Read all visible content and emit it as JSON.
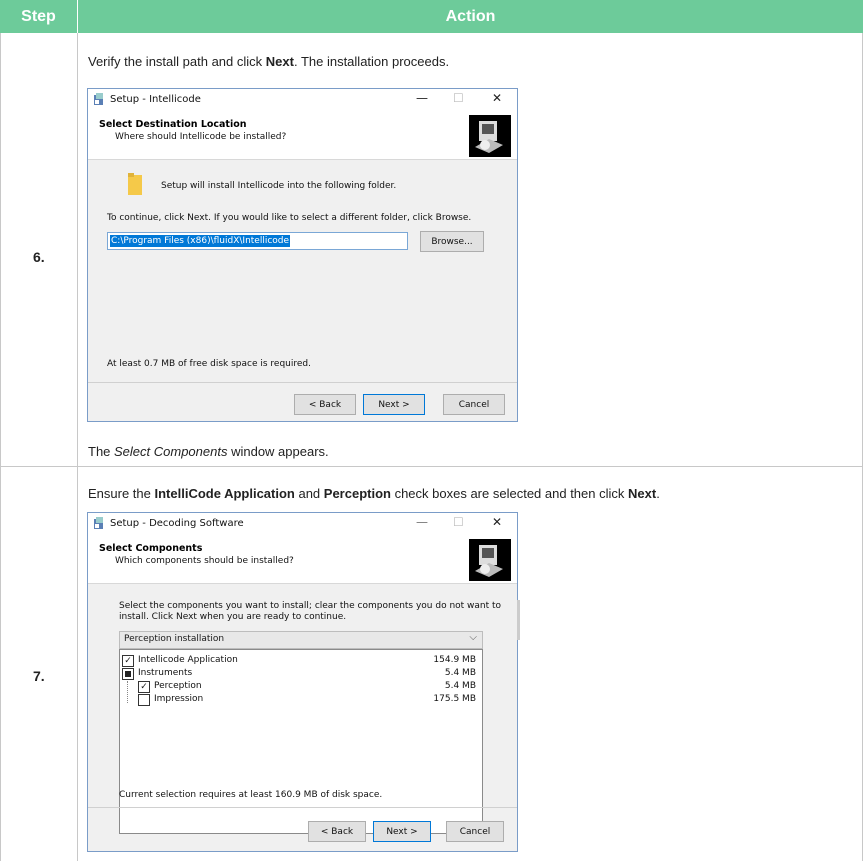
{
  "table": {
    "header_step": "Step",
    "header_action": "Action"
  },
  "step6": {
    "number": "6.",
    "intro_a": "Verify the install path and click ",
    "intro_b": "Next",
    "intro_c": ". The installation proceeds.",
    "outro_a": "The ",
    "outro_b": "Select Components",
    "outro_c": " window appears.",
    "dialog": {
      "title": "Setup - Intellicode",
      "heading": "Select Destination Location",
      "subheading": "Where should Intellicode be installed?",
      "folder_msg": "Setup will install Intellicode into the following folder.",
      "continue_msg": "To continue, click Next. If you would like to select a different folder, click Browse.",
      "path_value": "C:\\Program Files (x86)\\fluidX\\Intellicode",
      "browse_label": "Browse...",
      "space_msg": "At least 0.7 MB of free disk space is required.",
      "back_label": "< Back",
      "next_label": "Next >",
      "cancel_label": "Cancel"
    }
  },
  "step7": {
    "number": "7.",
    "intro_a": "Ensure the ",
    "intro_b": "IntelliCode Application",
    "intro_c": " and ",
    "intro_d": "Perception",
    "intro_e": " check boxes are selected and then click ",
    "intro_f": "Next",
    "intro_g": ".",
    "dialog": {
      "title": "Setup - Decoding Software",
      "heading": "Select Components",
      "subheading": "Which components should be installed?",
      "instr_line1": "Select the components you want to install; clear the components you do not want to",
      "instr_line2": "install. Click Next when you are ready to continue.",
      "dropdown_value": "Perception installation",
      "components": [
        {
          "label": "Intellicode Application",
          "size": "154.9 MB",
          "state": "checked"
        },
        {
          "label": "Instruments",
          "size": "5.4 MB",
          "state": "partial"
        },
        {
          "label": "Perception",
          "size": "5.4 MB",
          "state": "checked"
        },
        {
          "label": "Impression",
          "size": "175.5 MB",
          "state": "unchecked"
        }
      ],
      "selection_msg": "Current selection requires at least 160.9 MB of disk space.",
      "back_label": "< Back",
      "next_label": "Next >",
      "cancel_label": "Cancel"
    }
  }
}
